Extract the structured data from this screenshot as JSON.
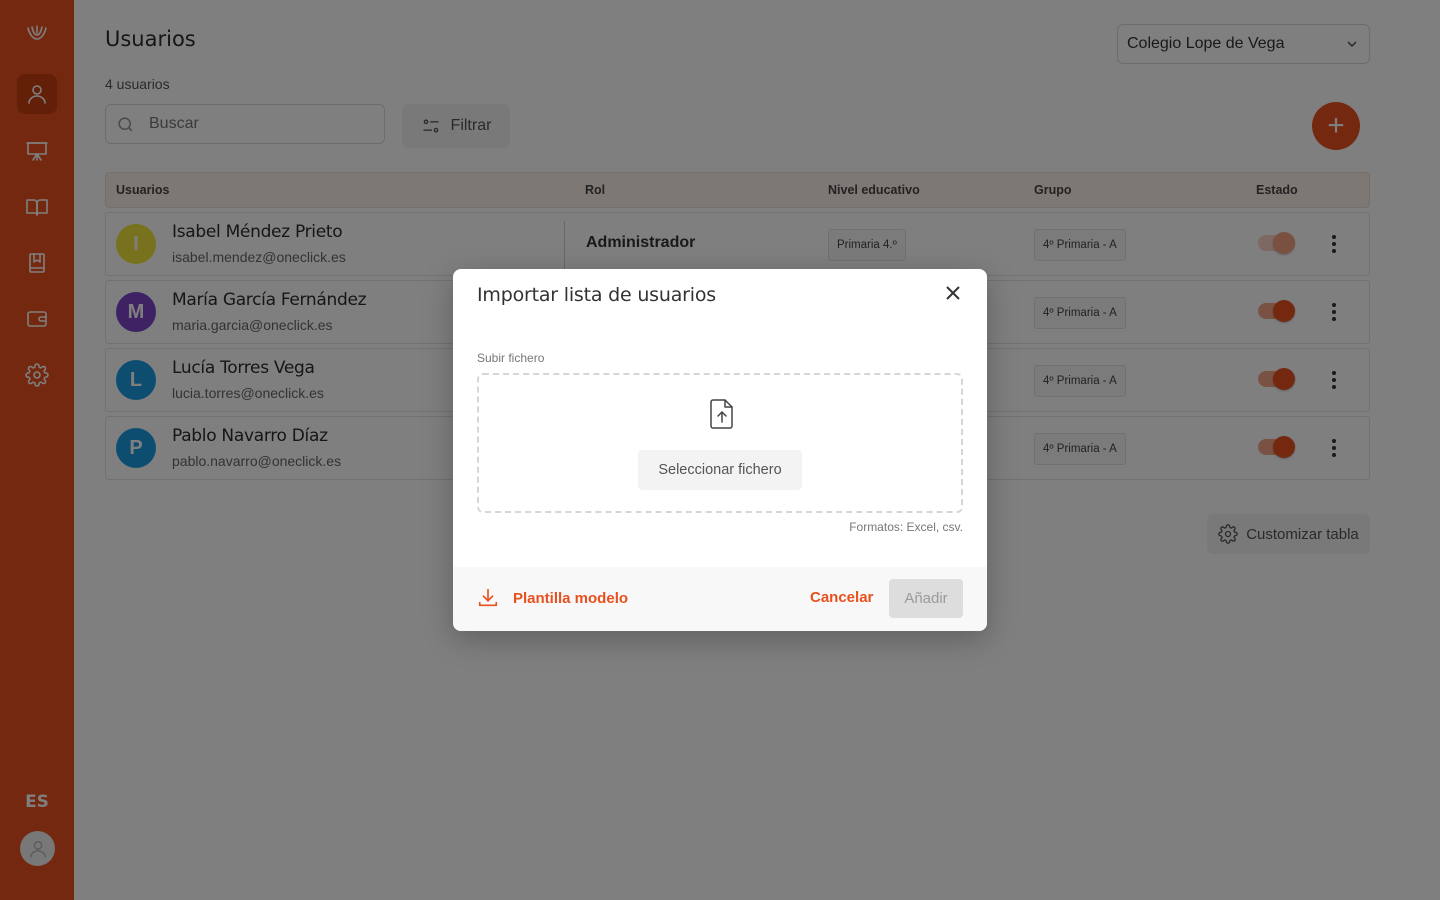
{
  "sidebar": {
    "icons": [
      "logo-icon",
      "user-icon",
      "presentation-board-icon",
      "book-open-icon",
      "notebook-icon",
      "wallet-icon",
      "gear-icon"
    ],
    "language": "ES"
  },
  "header": {
    "title": "Usuarios",
    "count": "4 usuarios",
    "school": "Colegio Lope de Vega"
  },
  "toolbar": {
    "search_placeholder": "Buscar",
    "filter_label": "Filtrar",
    "add_label": "+"
  },
  "table": {
    "columns": [
      "Usuarios",
      "Rol",
      "Nivel educativo",
      "Grupo",
      "Estado"
    ],
    "rows": [
      {
        "initial": "I",
        "name": "Isabel Méndez Prieto",
        "email": "isabel.mendez@oneclick.es",
        "role": "Administrador",
        "level": "Primaria 4.º",
        "group": "4º Primaria - A",
        "avatar_color": "#f0e23c",
        "active": true
      },
      {
        "initial": "M",
        "name": "María García Fernández",
        "email": "maria.garcia@oneclick.es",
        "role": "",
        "level": "",
        "group": "4º Primaria - A",
        "avatar_color": "#7e44c9",
        "active": true
      },
      {
        "initial": "L",
        "name": "Lucía Torres Vega",
        "email": "lucia.torres@oneclick.es",
        "role": "",
        "level": "",
        "group": "4º Primaria - A",
        "avatar_color": "#1a9ae0",
        "active": true
      },
      {
        "initial": "P",
        "name": "Pablo Navarro Díaz",
        "email": "pablo.navarro@oneclick.es",
        "role": "",
        "level": "",
        "group": "4º Primaria - A",
        "avatar_color": "#1a9ae0",
        "active": true
      }
    ]
  },
  "customize_label": "Customizar tabla",
  "modal": {
    "title": "Importar lista de usuarios",
    "upload_label": "Subir fichero",
    "select_file_label": "Seleccionar fichero",
    "formats": "Formatos: Excel, csv.",
    "template_label": "Plantilla modelo",
    "cancel_label": "Cancelar",
    "add_label": "Añadir"
  },
  "colors": {
    "brand": "#e8501e",
    "overlay": "rgba(0,0,0,0.5)"
  }
}
